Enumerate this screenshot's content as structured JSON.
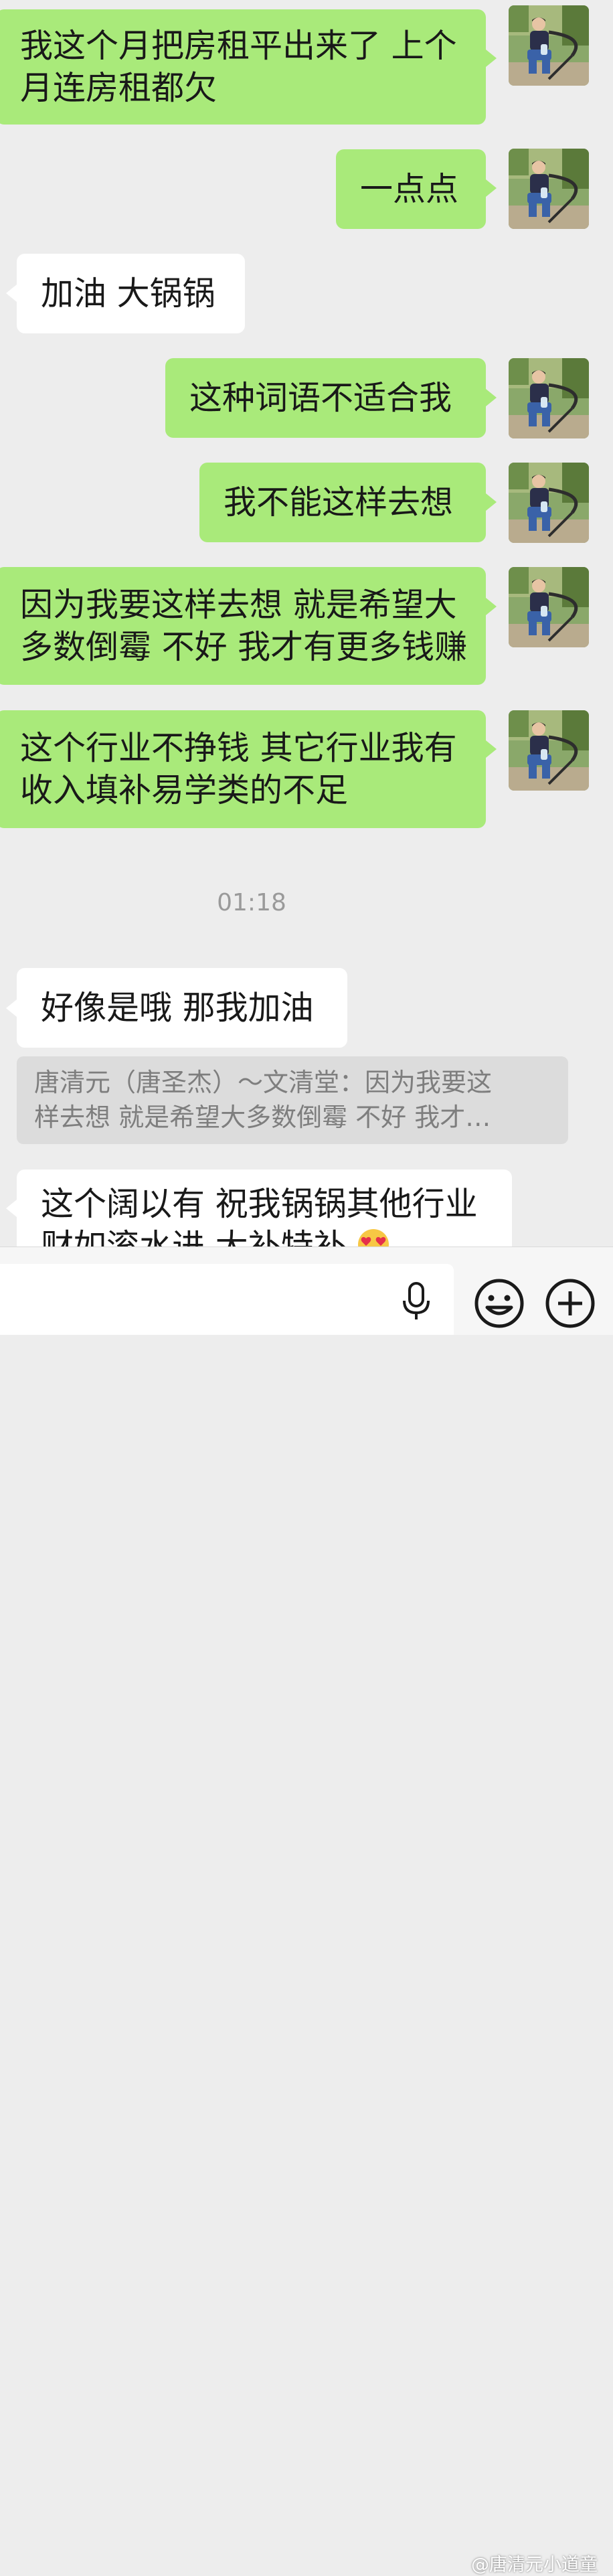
{
  "conversation": {
    "messages": [
      {
        "side": "out",
        "lines": [
          "我这个月把房租平出来了 上个",
          "月连房租都欠"
        ]
      },
      {
        "side": "out",
        "lines": [
          "一点点"
        ]
      },
      {
        "side": "in",
        "lines": [
          "加油 大锅锅"
        ]
      },
      {
        "side": "out",
        "lines": [
          "这种词语不适合我"
        ]
      },
      {
        "side": "out",
        "lines": [
          "我不能这样去想"
        ]
      },
      {
        "side": "out",
        "lines": [
          "因为我要这样去想 就是希望大",
          "多数倒霉 不好 我才有更多钱赚"
        ]
      },
      {
        "side": "out",
        "lines": [
          "这个行业不挣钱 其它行业我有",
          "收入填补易学类的不足"
        ]
      },
      {
        "side": "in",
        "lines": [
          "好像是哦 那我加油"
        ]
      },
      {
        "side": "in",
        "lines": [
          "这个阔以有 祝我锅锅其他行业",
          "财如滚水进 大补特补"
        ]
      }
    ],
    "timestamp": "01:18",
    "quote": {
      "lines": [
        "唐清元（唐圣杰）～文清堂：因为我要这",
        "样去想 就是希望大多数倒霉 不好 我才…"
      ]
    }
  },
  "input_bar": {
    "icons": [
      "microphone-icon",
      "emoji-icon",
      "plus-icon"
    ]
  },
  "watermark": "@唐清元小道童",
  "colors": {
    "background": "#ededed",
    "outgoing_bubble": "#a9ea7a",
    "incoming_bubble": "#ffffff",
    "quote_block": "#dcdcdc"
  }
}
